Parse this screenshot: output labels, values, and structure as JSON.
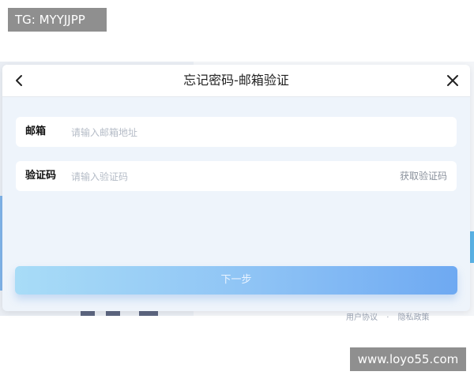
{
  "overlay": {
    "tg_tag": "TG: MYYJJPP",
    "watermark": "www.loyo55.com"
  },
  "background": {
    "footer_links": [
      "用户协议",
      "·",
      "隐私政策"
    ]
  },
  "modal": {
    "title": "忘记密码-邮箱验证",
    "back_icon": "chevron-left-icon",
    "close_icon": "close-icon",
    "email": {
      "label": "邮箱",
      "placeholder": "请输入邮箱地址",
      "value": ""
    },
    "code": {
      "label": "验证码",
      "placeholder": "请输入验证码",
      "value": "",
      "get_code_label": "获取验证码"
    },
    "next_button": "下一步"
  },
  "colors": {
    "button_start": "#a8dcf7",
    "button_end": "#6ea9f2",
    "modal_bg": "#eef4fb"
  }
}
